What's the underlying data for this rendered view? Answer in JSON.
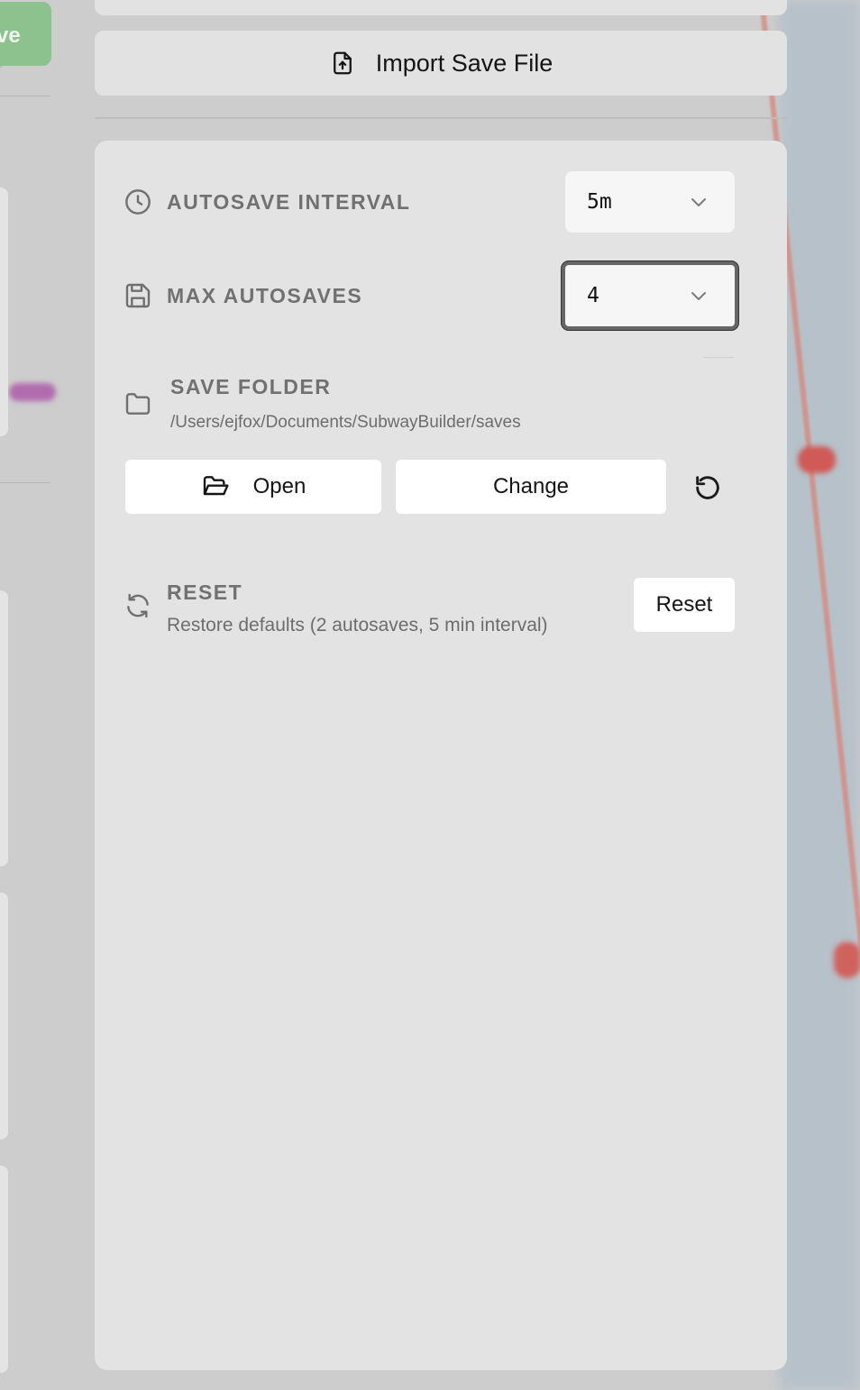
{
  "left_panel": {
    "save_button_fragment": "ve"
  },
  "import": {
    "label": "Import Save File",
    "icon": "file-upload-icon"
  },
  "autosave_interval": {
    "label": "AUTOSAVE INTERVAL",
    "value": "5m",
    "icon": "clock-icon"
  },
  "max_autosaves": {
    "label": "MAX AUTOSAVES",
    "value": "4",
    "icon": "floppy-disk-icon"
  },
  "save_folder": {
    "label": "SAVE FOLDER",
    "path": "/Users/ejfox/Documents/SubwayBuilder/saves",
    "open_label": "Open",
    "change_label": "Change",
    "icon": "folder-icon"
  },
  "reset": {
    "label": "RESET",
    "description": "Restore defaults (2 autosaves, 5 min interval)",
    "button_label": "Reset",
    "icon": "refresh-icon"
  },
  "colors": {
    "panel_bg": "#e3e3e3",
    "save_green": "#8cc28d",
    "label_gray": "#717171",
    "focus_ring": "#666666"
  }
}
